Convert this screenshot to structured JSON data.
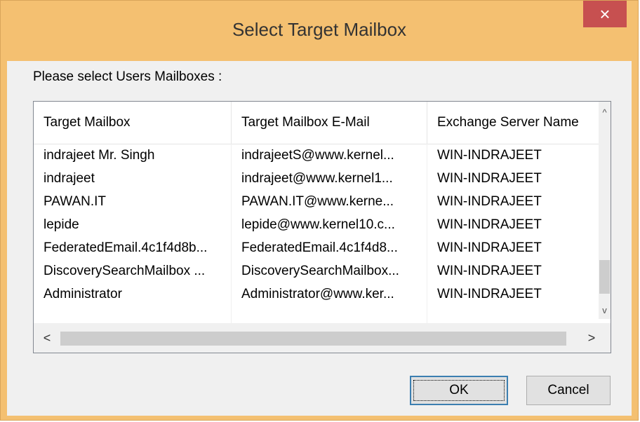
{
  "dialog": {
    "title": "Select Target Mailbox",
    "close_label": "×",
    "prompt": "Please select Users Mailboxes :"
  },
  "table": {
    "columns": [
      "Target Mailbox",
      "Target Mailbox E-Mail",
      "Exchange Server Name"
    ],
    "rows": [
      [
        "indrajeet Mr. Singh",
        "indrajeetS@www.kernel...",
        "WIN-INDRAJEET"
      ],
      [
        "indrajeet",
        "indrajeet@www.kernel1...",
        "WIN-INDRAJEET"
      ],
      [
        "PAWAN.IT",
        "PAWAN.IT@www.kerne...",
        "WIN-INDRAJEET"
      ],
      [
        "lepide",
        "lepide@www.kernel10.c...",
        "WIN-INDRAJEET"
      ],
      [
        "FederatedEmail.4c1f4d8b...",
        "FederatedEmail.4c1f4d8...",
        "WIN-INDRAJEET"
      ],
      [
        "DiscoverySearchMailbox ...",
        "DiscoverySearchMailbox...",
        "WIN-INDRAJEET"
      ],
      [
        "Administrator",
        "Administrator@www.ker...",
        "WIN-INDRAJEET"
      ],
      [
        "",
        "",
        ""
      ]
    ]
  },
  "scrollbars": {
    "up": "^",
    "down": "v",
    "left": "<",
    "right": ">"
  },
  "buttons": {
    "ok": "OK",
    "cancel": "Cancel"
  },
  "colors": {
    "title_bar": "#f4c071",
    "close": "#c75050"
  }
}
